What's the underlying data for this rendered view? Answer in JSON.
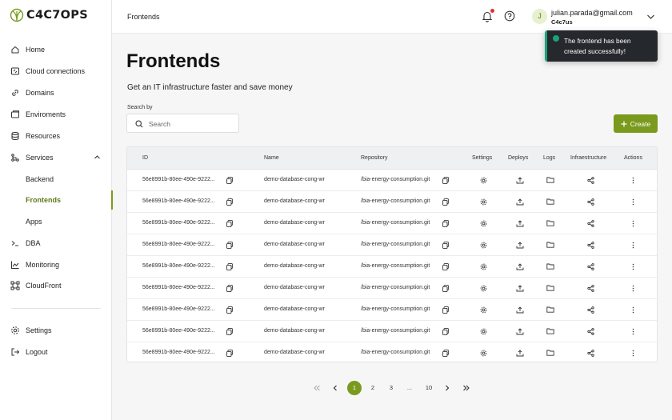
{
  "brand": {
    "logo_text": "C4C7OPS",
    "accent": "#7a9a1e"
  },
  "sidebar": {
    "items": [
      {
        "label": "Home",
        "icon": "home-icon"
      },
      {
        "label": "Cloud connections",
        "icon": "cloud-connections-icon"
      },
      {
        "label": "Domains",
        "icon": "link-icon"
      },
      {
        "label": "Enviroments",
        "icon": "environments-icon"
      },
      {
        "label": "Resources",
        "icon": "database-icon"
      },
      {
        "label": "Services",
        "icon": "services-icon",
        "expanded": true
      },
      {
        "label": "Backend"
      },
      {
        "label": "Frontends",
        "active": true
      },
      {
        "label": "Apps"
      },
      {
        "label": "DBA",
        "icon": "terminal-icon"
      },
      {
        "label": "Monitoring",
        "icon": "chart-icon"
      },
      {
        "label": "CloudFront",
        "icon": "cloudfront-icon"
      }
    ],
    "bottom": [
      {
        "label": "Settings",
        "icon": "gear-icon"
      },
      {
        "label": "Logout",
        "icon": "logout-icon"
      }
    ]
  },
  "topbar": {
    "title": "Frontends",
    "user": {
      "initial": "J",
      "email": "julian.parada@gmail.com",
      "org": "C4c7us"
    }
  },
  "toast": {
    "message": "The frontend has been created successfully!",
    "status_color": "#1aa37a"
  },
  "main": {
    "title": "Frontends",
    "subtitle": "Get an IT infrastructure faster and save money",
    "search": {
      "label": "Search by",
      "placeholder": "Search",
      "value": ""
    },
    "create_label": "Create"
  },
  "table": {
    "columns": [
      "ID",
      "Name",
      "Repository",
      "Settings",
      "Deploys",
      "Logs",
      "Infraestructure",
      "Actions"
    ],
    "rows": [
      {
        "id": "56e8991b-80ee-490e-9222...",
        "name": "demo-database-cong-wr",
        "repository": "/bia-energy-consumption.git"
      },
      {
        "id": "56e8991b-80ee-490e-9222...",
        "name": "demo-database-cong-wr",
        "repository": "/bia-energy-consumption.git"
      },
      {
        "id": "56e8991b-80ee-490e-9222...",
        "name": "demo-database-cong-wr",
        "repository": "/bia-energy-consumption.git"
      },
      {
        "id": "56e8991b-80ee-490e-9222...",
        "name": "demo-database-cong-wr",
        "repository": "/bia-energy-consumption.git"
      },
      {
        "id": "56e8991b-80ee-490e-9222...",
        "name": "demo-database-cong-wr",
        "repository": "/bia-energy-consumption.git"
      },
      {
        "id": "56e8991b-80ee-490e-9222...",
        "name": "demo-database-cong-wr",
        "repository": "/bia-energy-consumption.git"
      },
      {
        "id": "56e8991b-80ee-490e-9222...",
        "name": "demo-database-cong-wr",
        "repository": "/bia-energy-consumption.git"
      },
      {
        "id": "56e8991b-80ee-490e-9222...",
        "name": "demo-database-cong-wr",
        "repository": "/bia-energy-consumption.git"
      },
      {
        "id": "56e8991b-80ee-490e-9222...",
        "name": "demo-database-cong-wr",
        "repository": "/bia-energy-consumption.git"
      }
    ]
  },
  "pagination": {
    "pages": [
      "1",
      "2",
      "3",
      "...",
      "10"
    ],
    "current": "1"
  }
}
